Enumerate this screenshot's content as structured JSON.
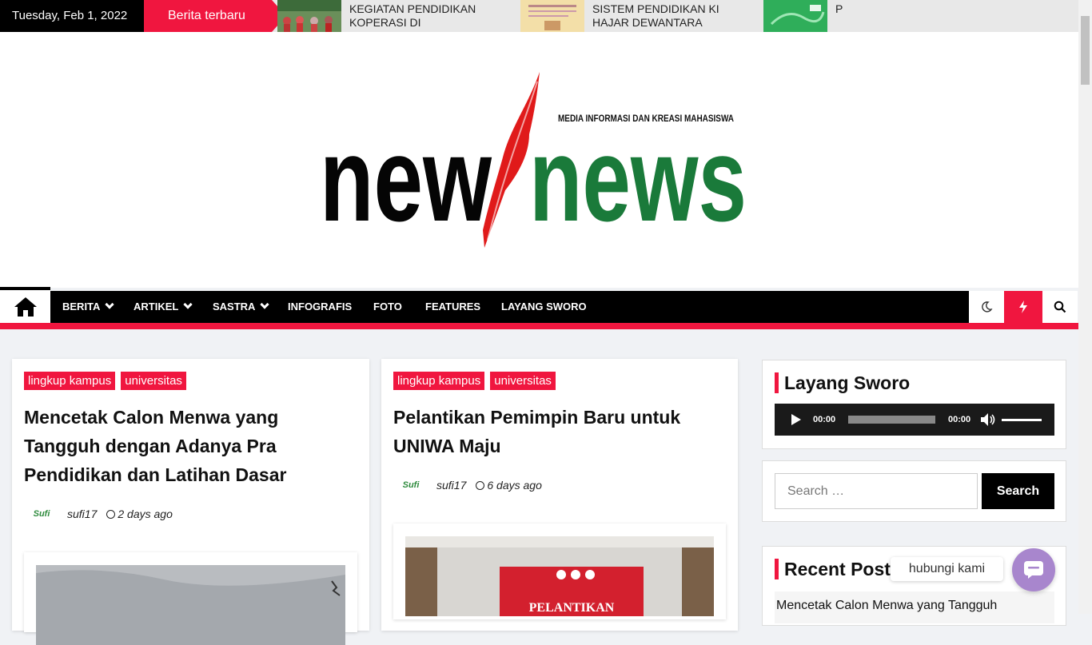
{
  "topbar": {
    "date": "Tuesday, Feb 1, 2022",
    "latest_label": "Berita terbaru",
    "ticker": [
      {
        "title": "KEGIATAN PENDIDIKAN KOPERASI DI UNIVERSITA…"
      },
      {
        "title": "SISTEM PENDIDIKAN KI HAJAR DEWANTARA"
      },
      {
        "title": "P"
      }
    ]
  },
  "logo": {
    "tagline": "MEDIA INFORMASI DAN KREASI MAHASISWA",
    "word1": "new",
    "word2": "news"
  },
  "nav": {
    "items": [
      {
        "label": "BERITA"
      },
      {
        "label": "ARTIKEL"
      },
      {
        "label": "SASTRA"
      },
      {
        "label": "INFOGRAFIS"
      },
      {
        "label": "FOTO"
      },
      {
        "label": "FEATURES"
      },
      {
        "label": "LAYANG SWORO"
      }
    ]
  },
  "posts": [
    {
      "tags": [
        "lingkup kampus",
        "universitas"
      ],
      "title_lines": [
        "Mencetak Calon Menwa yang",
        "Tangguh dengan Adanya Pra",
        "Pendidikan dan Latihan Dasar"
      ],
      "author": "sufi17",
      "time": "2 days ago",
      "avatar": "Sufi"
    },
    {
      "tags": [
        "lingkup kampus",
        "universitas"
      ],
      "title_lines": [
        "Pelantikan Pemimpin Baru untuk",
        "UNIWA Maju"
      ],
      "author": "sufi17",
      "time": "6 days ago",
      "avatar": "Sufi",
      "banner_text": "PELANTIKAN"
    }
  ],
  "sidebar": {
    "layang_title": "Layang Sworo",
    "audio": {
      "current": "00:00",
      "duration": "00:00"
    },
    "search": {
      "placeholder": "Search …",
      "button": "Search"
    },
    "recent_title": "Recent Post",
    "recent_first": "Mencetak Calon Menwa yang Tangguh"
  },
  "chat": {
    "label": "hubungi kami"
  },
  "colors": {
    "accent": "#f0163f",
    "brand_green": "#1a7a3a",
    "chat": "#a886cd"
  }
}
